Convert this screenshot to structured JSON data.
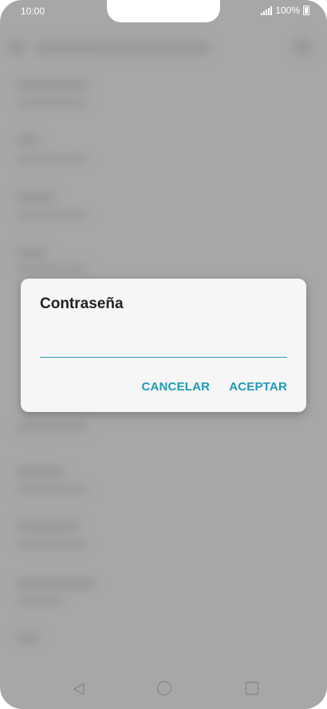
{
  "status_bar": {
    "time": "10:00",
    "battery_text": "100%"
  },
  "dialog": {
    "title": "Contraseña",
    "password_value": "",
    "password_placeholder": "",
    "cancel_label": "CANCELAR",
    "accept_label": "ACEPTAR"
  },
  "nav_bar": {
    "icons": [
      "back-icon",
      "home-icon",
      "recents-icon"
    ]
  },
  "colors": {
    "accent": "#1e9bb4",
    "scrim": "#a7a7a7",
    "dialog_bg": "#f6f6f6"
  }
}
